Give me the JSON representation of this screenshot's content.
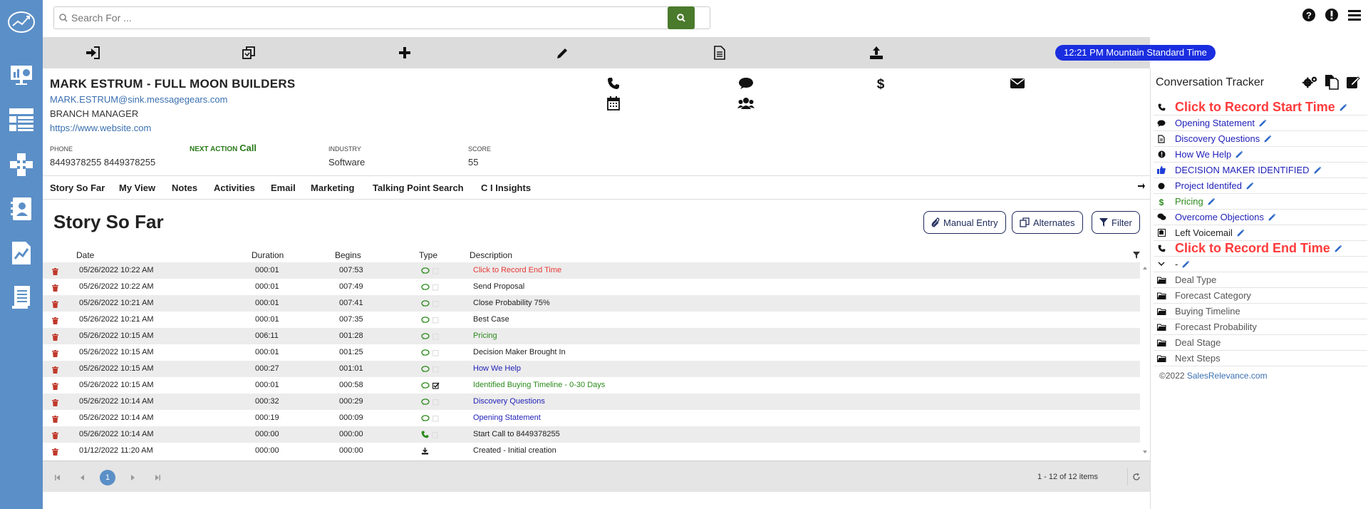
{
  "search": {
    "placeholder": "Search For ..."
  },
  "toolbar": {
    "time": "12:21 PM Mountain Standard Time"
  },
  "contact": {
    "name": "MARK ESTRUM - FULL MOON BUILDERS",
    "email": "MARK.ESTRUM@sink.messagegears.com",
    "title": "BRANCH MANAGER",
    "website": "https://www.website.com",
    "phone_label": "PHONE",
    "phone_value": "8449378255 8449378255",
    "next_action_label": "NEXT ACTION",
    "next_action_value": "Call",
    "industry_label": "INDUSTRY",
    "industry_value": "Software",
    "score_label": "SCORE",
    "score_value": "55"
  },
  "tabs": [
    "Story So Far",
    "My View",
    "Notes",
    "Activities",
    "Email",
    "Marketing",
    "Talking Point Search",
    "C I Insights"
  ],
  "story": {
    "title": "Story So Far",
    "manual_entry": "Manual Entry",
    "alternates": "Alternates",
    "filter": "Filter"
  },
  "grid": {
    "headers": {
      "date": "Date",
      "duration": "Duration",
      "begins": "Begins",
      "type": "Type",
      "description": "Description"
    },
    "rows": [
      {
        "date": "05/26/2022 10:22 AM",
        "duration": "000:01",
        "begins": "007:53",
        "type": "chat",
        "desc": "Click to Record End Time",
        "color": "#e53935"
      },
      {
        "date": "05/26/2022 10:22 AM",
        "duration": "000:01",
        "begins": "007:49",
        "type": "chat",
        "desc": "Send Proposal",
        "color": "#222222"
      },
      {
        "date": "05/26/2022 10:21 AM",
        "duration": "000:01",
        "begins": "007:41",
        "type": "chat",
        "desc": "Close Probability 75%",
        "color": "#222222"
      },
      {
        "date": "05/26/2022 10:21 AM",
        "duration": "000:01",
        "begins": "007:35",
        "type": "chat",
        "desc": "Best Case",
        "color": "#222222"
      },
      {
        "date": "05/26/2022 10:15 AM",
        "duration": "006:11",
        "begins": "001:28",
        "type": "chat",
        "desc": "Pricing",
        "color": "#2a8a1a"
      },
      {
        "date": "05/26/2022 10:15 AM",
        "duration": "000:01",
        "begins": "001:25",
        "type": "chat",
        "desc": "Decision Maker Brought In",
        "color": "#222222"
      },
      {
        "date": "05/26/2022 10:15 AM",
        "duration": "000:27",
        "begins": "001:01",
        "type": "chat",
        "desc": "How We Help",
        "color": "#1f1fb8"
      },
      {
        "date": "05/26/2022 10:15 AM",
        "duration": "000:01",
        "begins": "000:58",
        "type": "chat-check",
        "desc": "Identified Buying Timeline - 0-30 Days",
        "color": "#2a8a1a"
      },
      {
        "date": "05/26/2022 10:14 AM",
        "duration": "000:32",
        "begins": "000:29",
        "type": "chat",
        "desc": "Discovery Questions",
        "color": "#1f1fb8"
      },
      {
        "date": "05/26/2022 10:14 AM",
        "duration": "000:19",
        "begins": "000:09",
        "type": "chat",
        "desc": "Opening Statement",
        "color": "#1f1fb8"
      },
      {
        "date": "05/26/2022 10:14 AM",
        "duration": "000:00",
        "begins": "000:00",
        "type": "phone",
        "desc": "Start Call to 8449378255",
        "color": "#222222"
      },
      {
        "date": "01/12/2022 11:20 AM",
        "duration": "000:00",
        "begins": "000:00",
        "type": "download",
        "desc": "Created - Initial creation",
        "color": "#222222"
      }
    ]
  },
  "pager": {
    "current": "1",
    "count": "1 - 12 of 12 items"
  },
  "tracker": {
    "title": "Conversation Tracker",
    "items": [
      {
        "icon": "phone-icon",
        "label": "Click to Record Start Time",
        "style": "big",
        "pen": true
      },
      {
        "icon": "comment-icon",
        "label": "Opening Statement",
        "style": "link",
        "pen": true
      },
      {
        "icon": "document-icon",
        "label": "Discovery Questions",
        "style": "link",
        "pen": true
      },
      {
        "icon": "exclamation-icon",
        "label": "How We Help",
        "style": "link",
        "pen": true
      },
      {
        "icon": "thumbs-up-icon",
        "label": "DECISION MAKER IDENTIFIED",
        "style": "link",
        "pen": true
      },
      {
        "icon": "circle-icon",
        "label": "Project Identifed",
        "style": "link",
        "pen": true
      },
      {
        "icon": "dollar-icon",
        "label": "Pricing",
        "style": "green",
        "pen": true
      },
      {
        "icon": "comments-icon",
        "label": "Overcome Objections",
        "style": "link",
        "pen": true
      },
      {
        "icon": "voicemail-icon",
        "label": "Left Voicemail",
        "style": "dark",
        "pen": true
      },
      {
        "icon": "phone-icon",
        "label": "Click to Record End Time",
        "style": "big",
        "pen": true
      },
      {
        "icon": "chevron-down-icon",
        "label": "-",
        "style": "dark",
        "pen": true
      },
      {
        "icon": "folder-icon",
        "label": "Deal Type",
        "style": "grey",
        "pen": false
      },
      {
        "icon": "folder-icon",
        "label": "Forecast Category",
        "style": "grey",
        "pen": false
      },
      {
        "icon": "folder-icon",
        "label": "Buying Timeline",
        "style": "grey",
        "pen": false
      },
      {
        "icon": "folder-icon",
        "label": "Forecast Probability",
        "style": "grey",
        "pen": false
      },
      {
        "icon": "folder-icon",
        "label": "Deal Stage",
        "style": "grey",
        "pen": false
      },
      {
        "icon": "folder-icon",
        "label": "Next Steps",
        "style": "grey",
        "pen": false
      }
    ],
    "copyright_prefix": "©2022 ",
    "copyright_link": "SalesRelevance.com"
  }
}
